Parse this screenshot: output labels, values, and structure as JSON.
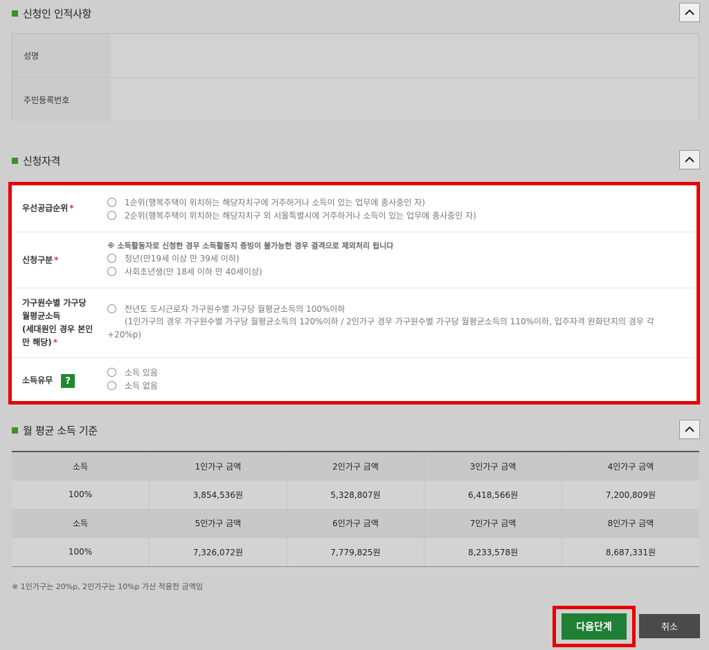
{
  "applicant": {
    "title": "신청인 인적사항",
    "fields": [
      {
        "label": "성명",
        "value": ""
      },
      {
        "label": "주민등록번호",
        "value": ""
      }
    ]
  },
  "qualification": {
    "title": "신청자격",
    "priority": {
      "label": "우선공급순위",
      "options": [
        "1순위(행복주택이 위치하는 해당자치구에 거주하거나 소득이 있는 업무에 종사중인 자)",
        "2순위(행복주택이 위치하는 해당자치구 외 서울특별시에 거주하거나 소득이 있는 업무에 종사중인 자)"
      ]
    },
    "category": {
      "label": "신청구분",
      "notice": "※ 소득활동자로 신청한 경우 소득활동지 증빙이 불가능한 경우 결격으로 제외처리 됩니다",
      "options": [
        "청년(만19세 이상 만 39세 이하)",
        "사회초년생(만 18세 이하 만 40세이상)"
      ]
    },
    "household_income": {
      "label_lines": [
        "가구원수별 가구당",
        "월평균소득",
        "(세대원인 경우 본인",
        "만 해당)"
      ],
      "option": "전년도 도시근로자 가구원수별 가구당 월평균소득의 100%이하",
      "sub_line1": "(1인가구의 경우 가구원수별 가구당 월평균소득의 120%이하 / 2인가구 경우 가구원수별 가구당 월평균소득의 110%이하, 입주자격 완화단지의 경우 각",
      "sub_line2": "+20%p)"
    },
    "income_status": {
      "label": "소득유무",
      "help": "?",
      "options": [
        "소득 있음",
        "소득 없음"
      ]
    }
  },
  "income_standard": {
    "title": "월 평균 소득 기준",
    "rows": [
      [
        "소득",
        "1인가구 금액",
        "2인가구 금액",
        "3인가구 금액",
        "4인가구 금액"
      ],
      [
        "100%",
        "3,854,536원",
        "5,328,807원",
        "6,418,566원",
        "7,200,809원"
      ],
      [
        "소득",
        "5인가구 금액",
        "6인가구 금액",
        "7인가구 금액",
        "8인가구 금액"
      ],
      [
        "100%",
        "7,326,072원",
        "7,779,825원",
        "8,233,578원",
        "8,687,331원"
      ]
    ],
    "footnote": "※ 1인가구는 20%p, 2인가구는 10%p 가산 적용한 금액임"
  },
  "actions": {
    "next": "다음단계",
    "cancel": "취소"
  },
  "colors": {
    "accent_green": "#1f7f34",
    "highlight_red": "#e60000"
  }
}
